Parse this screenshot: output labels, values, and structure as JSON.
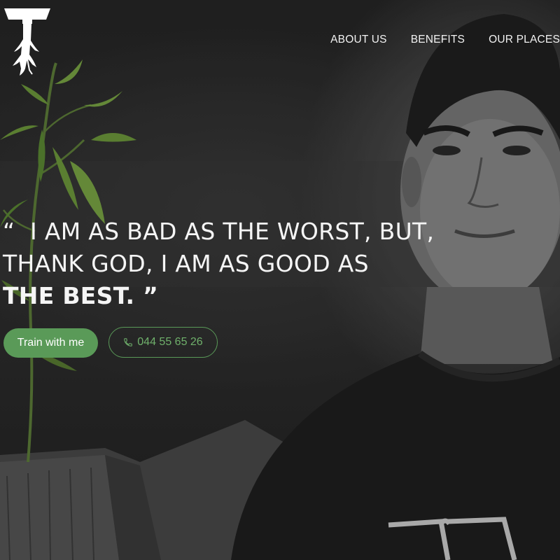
{
  "nav": {
    "items": [
      {
        "label": "ABOUT US"
      },
      {
        "label": "BENEFITS"
      },
      {
        "label": "OUR PLACES"
      }
    ]
  },
  "hero": {
    "quote_open": "“",
    "quote_line1": "I AM AS BAD AS THE WORST, BUT,",
    "quote_line2": "THANK GOD, I AM AS GOOD AS",
    "quote_line3": "THE BEST.",
    "quote_close": "”",
    "primary_button": "Train with me",
    "phone": "044 55 65 26"
  },
  "colors": {
    "accent": "#5a9a58",
    "accent_text": "#6fb06b"
  },
  "icons": {
    "logo": "tree-root-logo",
    "phone": "phone-icon"
  }
}
